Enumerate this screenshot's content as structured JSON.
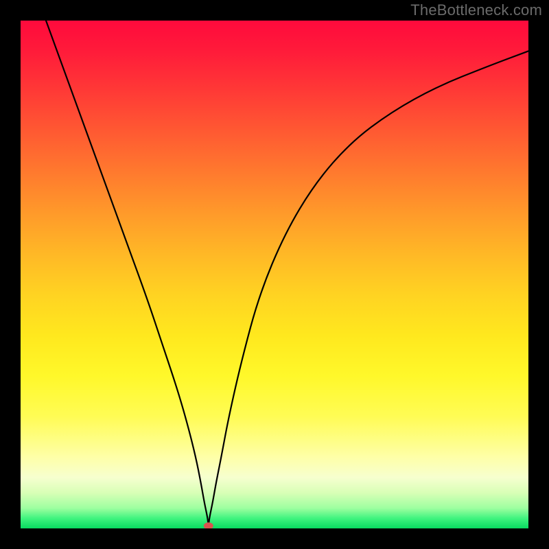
{
  "watermark": "TheBottleneck.com",
  "chart_data": {
    "type": "line",
    "title": "",
    "xlabel": "",
    "ylabel": "",
    "xlim": [
      0,
      100
    ],
    "ylim": [
      0,
      100
    ],
    "grid": false,
    "background": "gradient-rainbow-vertical",
    "series": [
      {
        "name": "curve",
        "x": [
          5,
          9,
          13,
          17,
          21,
          25,
          28,
          31,
          33,
          34.5,
          35.5,
          36.2,
          36.8,
          37,
          37.2,
          37.8,
          38.5,
          39.5,
          41,
          43.5,
          47,
          52,
          58,
          65,
          73,
          82,
          92,
          100
        ],
        "y": [
          100,
          89,
          78,
          67,
          56,
          45,
          36,
          27,
          20,
          14,
          9,
          5,
          2.2,
          0.5,
          2.2,
          5,
          9,
          14,
          22,
          33,
          46,
          58,
          68,
          76,
          82,
          87,
          91,
          94
        ]
      }
    ],
    "marker": {
      "x": 37,
      "y": 0.5
    },
    "marker_color": "#d9534f",
    "gradient_stops": [
      {
        "pos": 0,
        "color": "#ff0a3c"
      },
      {
        "pos": 0.5,
        "color": "#ffd322"
      },
      {
        "pos": 0.9,
        "color": "#feffa8"
      },
      {
        "pos": 1.0,
        "color": "#08da60"
      }
    ]
  }
}
